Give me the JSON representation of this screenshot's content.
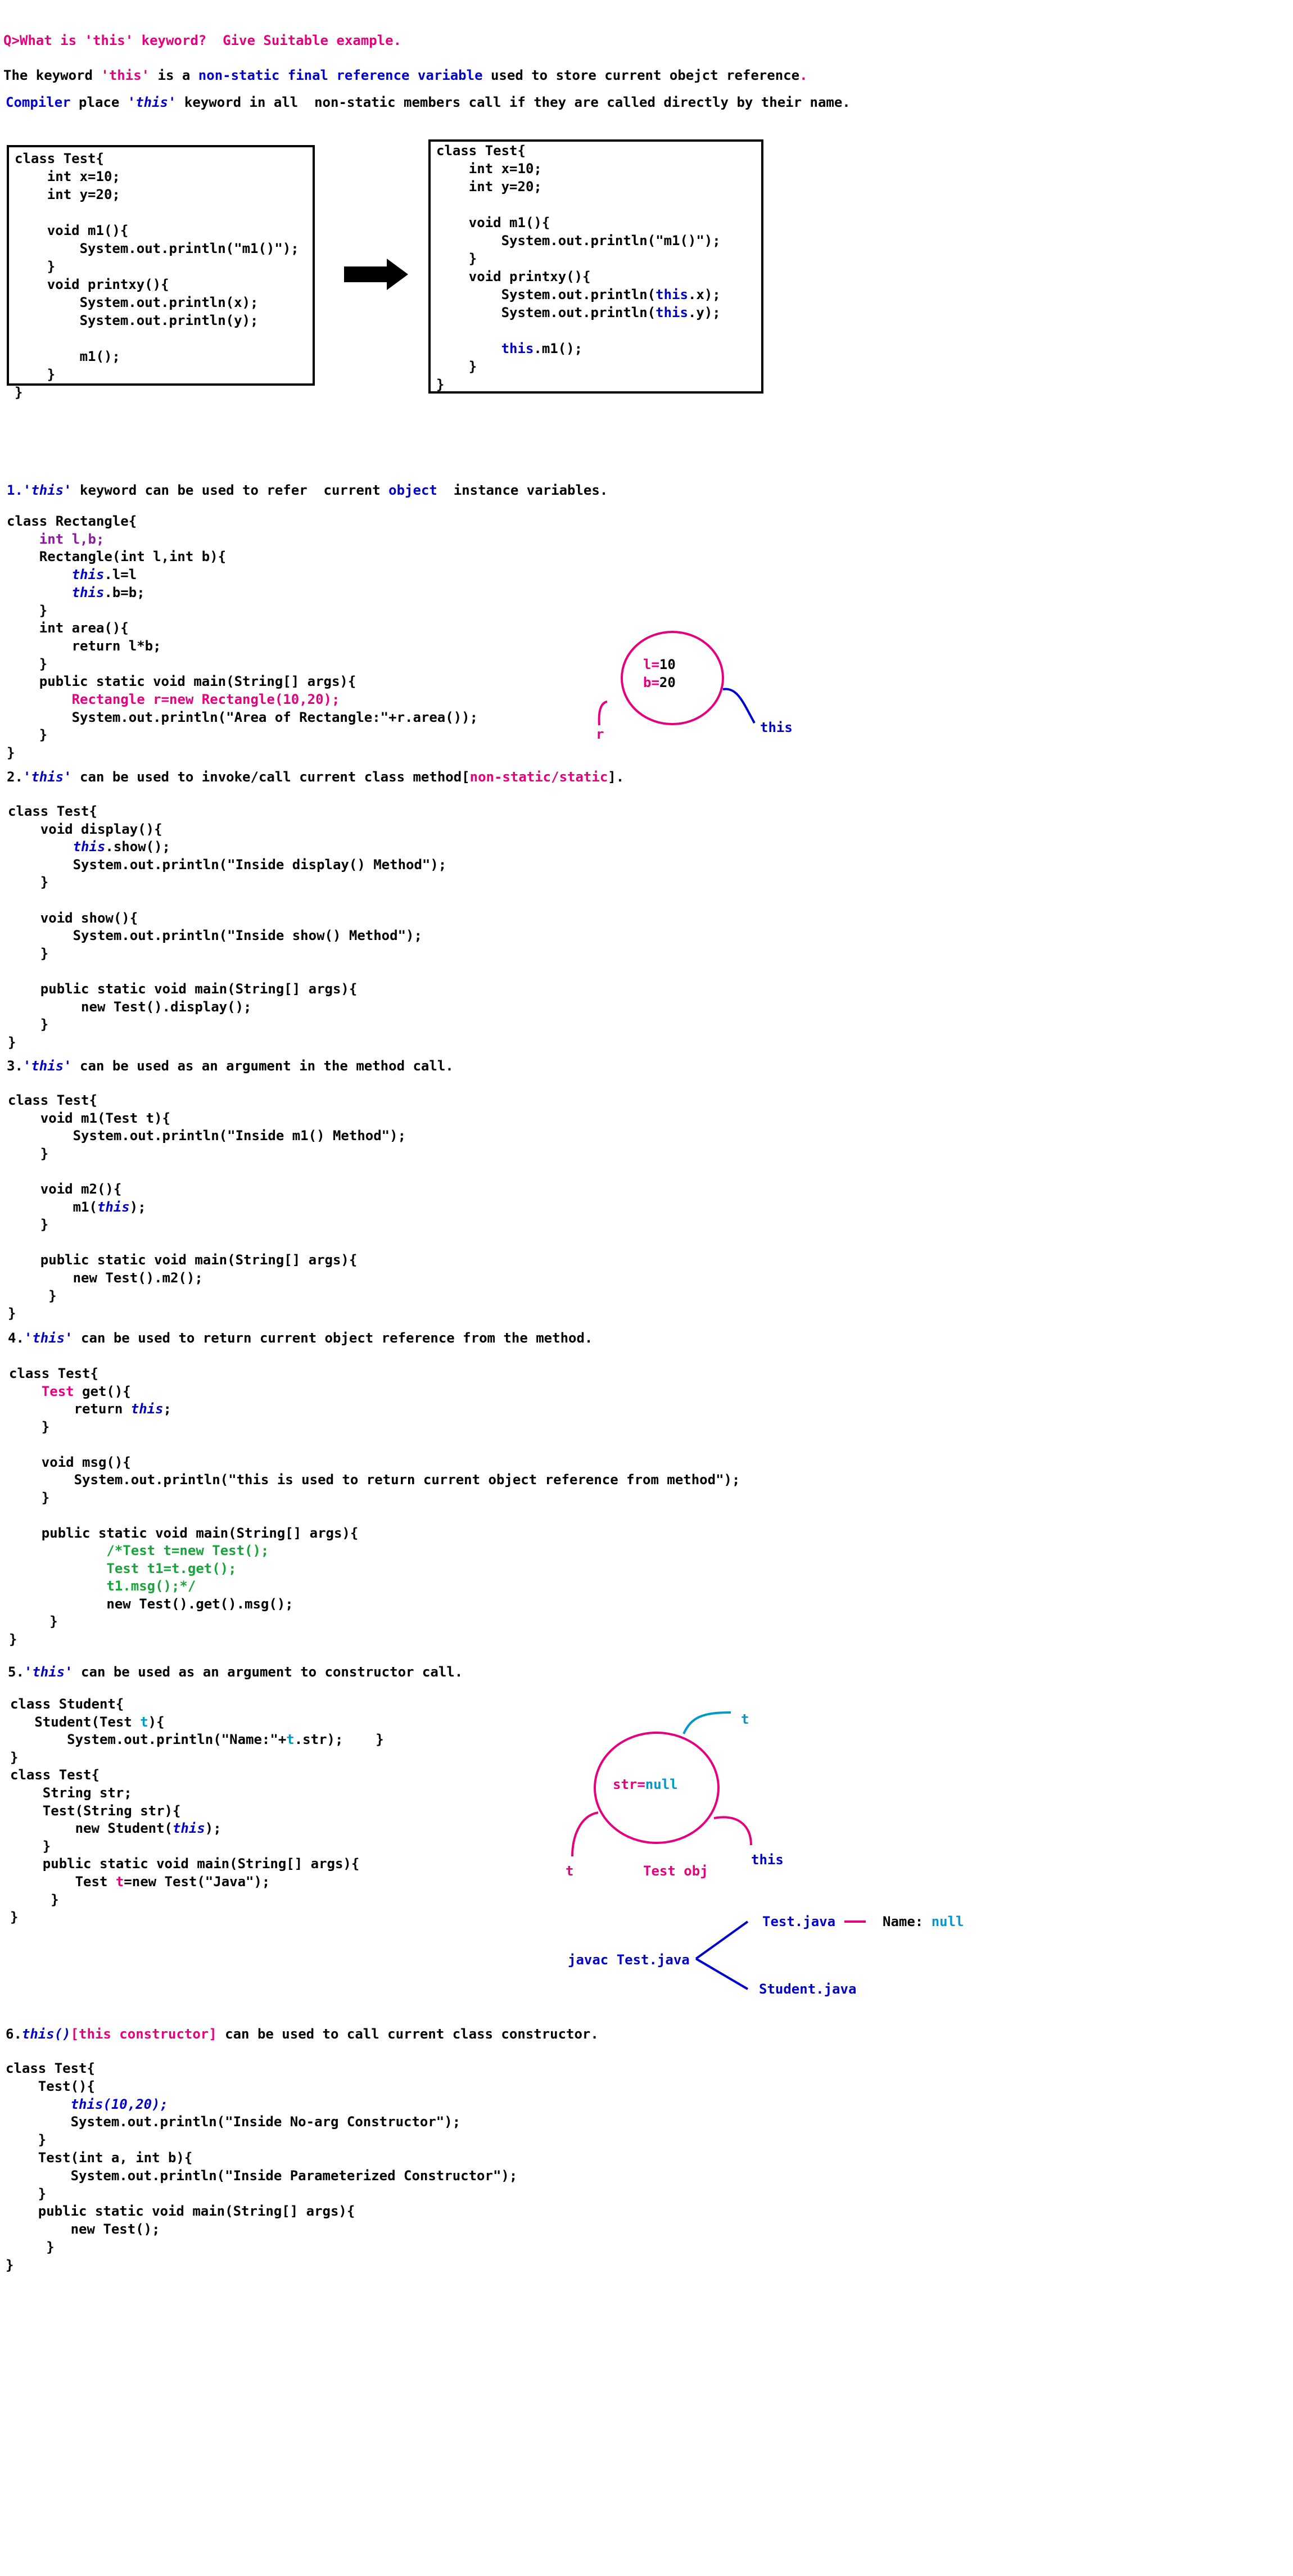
{
  "question": "Q>What is 'this' keyword?  Give Suitable example.",
  "intro": {
    "line1_a": "The keyword ",
    "line1_this": "'this'",
    "line1_b": " is a ",
    "line1_blue": "non-static final reference variable",
    "line1_c": " used to store current obejct reference",
    "line1_dot": ".",
    "line2_compiler": "Compiler",
    "line2_a": " place ",
    "line2_this": "'this'",
    "line2_b": " keyword in all  non-static members call if they are called directly by their name."
  },
  "box_before": [
    "class Test{",
    "    int x=10;",
    "    int y=20;",
    "",
    "    void m1(){",
    "        System.out.println(\"m1()\");",
    "    }",
    "    void printxy(){",
    "        System.out.println(x);",
    "        System.out.println(y);",
    "",
    "        m1();",
    "    }",
    "}"
  ],
  "box_after": {
    "l1": "class Test{",
    "l2": "    int x=10;",
    "l3": "    int y=20;",
    "l5": "    void m1(){",
    "l6": "        System.out.println(\"m1()\");",
    "l7": "    }",
    "l8": "    void printxy(){",
    "l9a": "        System.out.println(",
    "this": "this",
    "l9b": ".x);",
    "l10b": ".y);",
    "l12a": "        ",
    "l12b": ".m1();",
    "l13": "    }",
    "l14": "}"
  },
  "s1": {
    "num": "1.",
    "this": "'this'",
    "text_a": " keyword can be used to refer  current ",
    "object": "object",
    "text_b": "  instance variables.",
    "c1": "class Rectangle{",
    "c2": "    int l,b;",
    "c3": "    Rectangle(int l,int b){",
    "c4a": "        ",
    "this_kw": "this",
    "c4b": ".l=l",
    "c5b": ".b=b;",
    "c6": "    }",
    "c7": "    int area(){",
    "c8": "        return l*b;",
    "c9": "    }",
    "c10": "    public static void main(String[] args){",
    "c11": "        Rectangle r=new Rectangle(10,20);",
    "c12": "        System.out.println(\"Area of Rectangle:\"+r.area());",
    "c13": "    }",
    "c14": "}",
    "diagram": {
      "l_label": "l=",
      "l_val": "10",
      "b_label": "b=",
      "b_val": "20",
      "r": "r",
      "this": "this"
    }
  },
  "s2": {
    "num": "2.",
    "this": "'this'",
    "text_a": " can be used to invoke/call current class method[",
    "mag": "non-static/static",
    "text_b": "].",
    "c1": "class Test{",
    "c2": "    void display(){",
    "c3a": "        ",
    "this_kw": "this",
    "c3b": ".show();",
    "c4": "        System.out.println(\"Inside display() Method\");",
    "c5": "    }",
    "c7": "    void show(){",
    "c8": "        System.out.println(\"Inside show() Method\");",
    "c9": "    }",
    "c11": "    public static void main(String[] args){",
    "c12": "         new Test().display();",
    "c13": "    }",
    "c14": "}"
  },
  "s3": {
    "num": "3.",
    "this": "'this'",
    "text": " can be used as an argument in the method call.",
    "c1": "class Test{",
    "c2": "    void m1(Test t){",
    "c3": "        System.out.println(\"Inside m1() Method\");",
    "c4": "    }",
    "c6": "    void m2(){",
    "c7a": "        m1(",
    "this_kw": "this",
    "c7b": ");",
    "c8": "    }",
    "c10": "    public static void main(String[] args){",
    "c11": "        new Test().m2();",
    "c12": "     }",
    "c13": "}"
  },
  "s4": {
    "num": "4.",
    "this": "'this'",
    "text": " can be used to return current object reference from the method.",
    "c1": "class Test{",
    "c2a": "    ",
    "c2mag": "Test",
    "c2b": " get(){",
    "c3a": "        return ",
    "this_kw": "this",
    "c3b": ";",
    "c4": "    }",
    "c6": "    void msg(){",
    "c7": "        System.out.println(\"this is used to return current object reference from method\");",
    "c8": "    }",
    "c10": "    public static void main(String[] args){",
    "c11": "            /*Test t=new Test();",
    "c12": "            Test t1=t.get();",
    "c13": "            t1.msg();*/",
    "c14": "            new Test().get().msg();",
    "c15": "     }",
    "c16": "}"
  },
  "s5": {
    "num": "5.",
    "this": "'this'",
    "text": " can be used as an argument to constructor call.",
    "c1": "class Student{",
    "c2a": "   Student(Test ",
    "t": "t",
    "c2b": "){",
    "c3a": "       System.out.println(\"Name:\"+",
    "c3b": ".str);    }",
    "c4": "}",
    "c5": "class Test{",
    "c6": "    String str;",
    "c7": "    Test(String str){",
    "c8a": "        new Student(",
    "this_kw": "this",
    "c8b": ");",
    "c9": "    }",
    "c10": "    public static void main(String[] args){",
    "c11a": "        Test ",
    "c11b": "=new Test(\"Java\");",
    "c12": "     }",
    "c13": "}",
    "diagram": {
      "str_label": "str=",
      "null": "null",
      "t_top": "t",
      "t_bottom": "t",
      "test_obj": "Test obj",
      "this": "this",
      "javac": "javac Test.java",
      "test_java": "Test.java",
      "name_label": "Name:",
      "name_val": "null",
      "student_java": "Student.java"
    }
  },
  "s6": {
    "num": "6.",
    "this_call": "this()",
    "bracket": "[this constructor]",
    "text": " can be used to call current class constructor.",
    "c1": "class Test{",
    "c2": "    Test(){",
    "c3a": "        ",
    "c3this": "this(10,20);",
    "c4": "        System.out.println(\"Inside No-arg Constructor\");",
    "c5": "    }",
    "c6": "    Test(int a, int b){",
    "c7": "        System.out.println(\"Inside Parameterized Constructor\");",
    "c8": "    }",
    "c9": "    public static void main(String[] args){",
    "c10": "        new Test();",
    "c11": "     }",
    "c12": "}"
  },
  "colors": {
    "magenta": "#e6007e",
    "blue": "#0000cc",
    "cyan": "#0099cc",
    "green": "#1aa33a",
    "purple": "#8a1a9a"
  },
  "icons": {
    "arrow": "right-arrow-icon"
  }
}
